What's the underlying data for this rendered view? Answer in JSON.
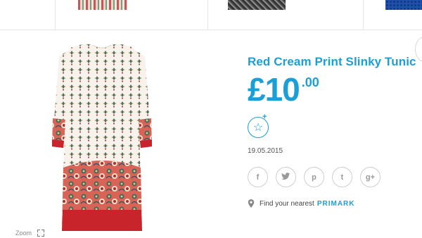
{
  "product": {
    "title": "Red Cream Print Slinky Tunic",
    "price_main": "£10",
    "price_decimal": ".00",
    "date": "19.05.2015"
  },
  "favourite": {
    "icon": "star-icon",
    "plus": "+"
  },
  "share": [
    {
      "name": "facebook",
      "glyph": "f"
    },
    {
      "name": "twitter",
      "glyph": "t"
    },
    {
      "name": "pinterest",
      "glyph": "p"
    },
    {
      "name": "tumblr",
      "glyph": "t"
    },
    {
      "name": "google-plus",
      "glyph": "g+"
    }
  ],
  "store": {
    "label": "Find your nearest",
    "brand": "PRIMARK"
  },
  "zoom": {
    "label": "Zoom"
  },
  "colors": {
    "accent": "#1a9fd6",
    "print_red": "#c8242c"
  }
}
